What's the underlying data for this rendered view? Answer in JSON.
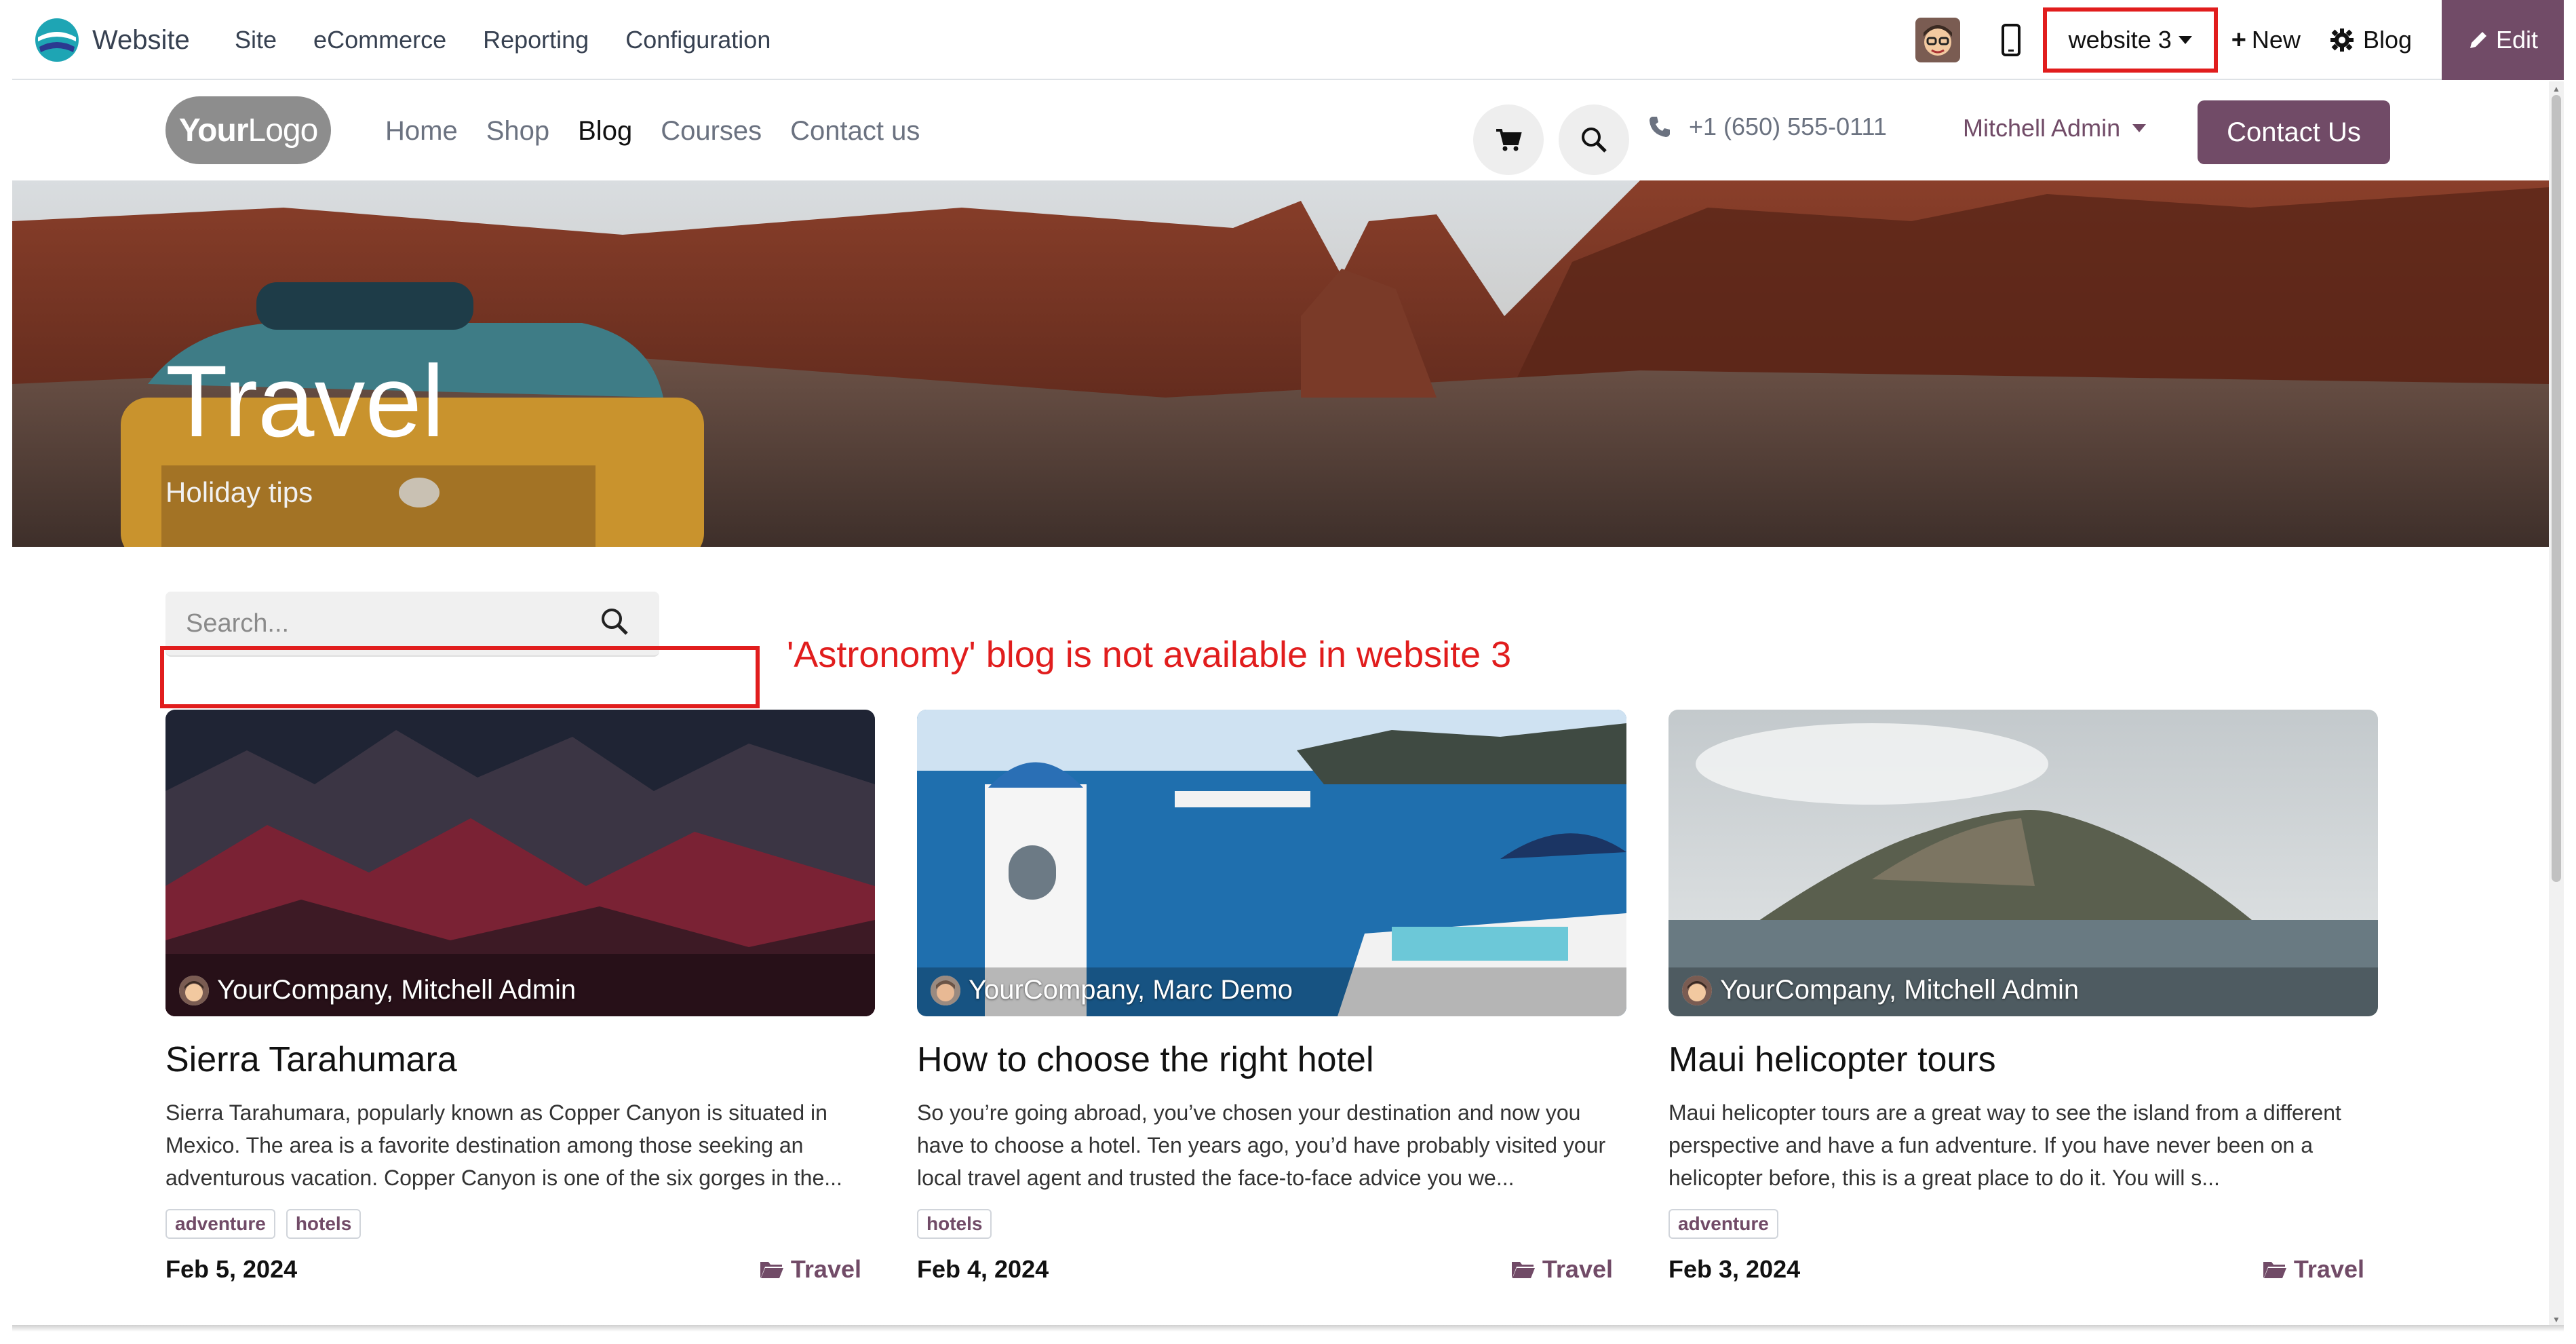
{
  "admin_bar": {
    "app_name": "Website",
    "menu": [
      "Site",
      "eCommerce",
      "Reporting",
      "Configuration"
    ],
    "website_switcher": "website 3",
    "new_label": "New",
    "blog_label": "Blog",
    "edit_label": "Edit",
    "accent_color": "#714b67"
  },
  "site": {
    "logo_text_bold": "Your",
    "logo_text_light": "Logo",
    "nav": [
      "Home",
      "Shop",
      "Blog",
      "Courses",
      "Contact us"
    ],
    "active_nav": "Blog",
    "phone": "+1 (650) 555-0111",
    "user": "Mitchell Admin",
    "contact_button": "Contact Us"
  },
  "hero": {
    "title": "Travel",
    "subtitle": "Holiday tips"
  },
  "search": {
    "placeholder": "Search..."
  },
  "annotation": {
    "text": "'Astronomy' blog is not available in website 3",
    "color": "#e11d1d"
  },
  "posts": [
    {
      "author": "YourCompany, Mitchell Admin",
      "title": "Sierra Tarahumara",
      "excerpt": "Sierra Tarahumara, popularly known as Copper Canyon is situated in Mexico. The area is a favorite destination among those seeking an adventurous vacation. Copper Canyon is one of the six gorges in the...",
      "tags": [
        "adventure",
        "hotels"
      ],
      "date": "Feb 5, 2024",
      "category": "Travel"
    },
    {
      "author": "YourCompany, Marc Demo",
      "title": "How to choose the right hotel",
      "excerpt": "So you’re going abroad, you’ve chosen your destination and now you have to choose a hotel. Ten years ago, you’d have probably visited your local travel agent and trusted the face-to-face advice you we...",
      "tags": [
        "hotels"
      ],
      "date": "Feb 4, 2024",
      "category": "Travel"
    },
    {
      "author": "YourCompany, Mitchell Admin",
      "title": "Maui helicopter tours",
      "excerpt": "Maui helicopter tours are a great way to see the island from a different perspective and have a fun adventure. If you have never been on a helicopter before, this is a great place to do it. You will s...",
      "tags": [
        "adventure"
      ],
      "date": "Feb 3, 2024",
      "category": "Travel"
    }
  ]
}
